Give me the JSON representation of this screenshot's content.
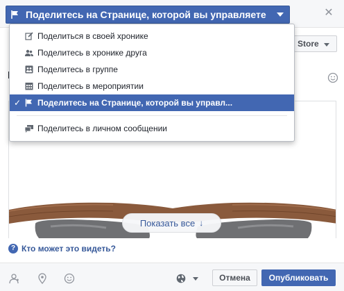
{
  "header": {
    "share_target_label": "Поделитесь на Странице, которой вы управляете",
    "close_symbol": "✕"
  },
  "menu": {
    "items": [
      {
        "label": "Поделиться в своей хронике",
        "icon": "pencil-icon"
      },
      {
        "label": "Поделитесь в хронике друга",
        "icon": "friends-icon"
      },
      {
        "label": "Поделитесь в группе",
        "icon": "group-icon"
      },
      {
        "label": "Поделитесь в мероприятии",
        "icon": "calendar-icon"
      },
      {
        "label": "Поделитесь на Странице, которой вы управл...",
        "icon": "flag-icon",
        "selected": true
      }
    ],
    "message_item": {
      "label": "Поделитесь в личном сообщении",
      "icon": "messages-icon"
    },
    "check_symbol": "✓"
  },
  "composer": {
    "store_label": "Store",
    "left_fragment": "I",
    "show_all_label": "Показать все",
    "show_all_arrow": "↓",
    "who_can_see": "Кто может это видеть?",
    "help_symbol": "?"
  },
  "footer": {
    "cancel_label": "Отмена",
    "publish_label": "Опубликовать"
  },
  "colors": {
    "accent": "#4267b2",
    "link": "#365899",
    "wood": "#8a5a3c",
    "lens": "#6f7073"
  }
}
